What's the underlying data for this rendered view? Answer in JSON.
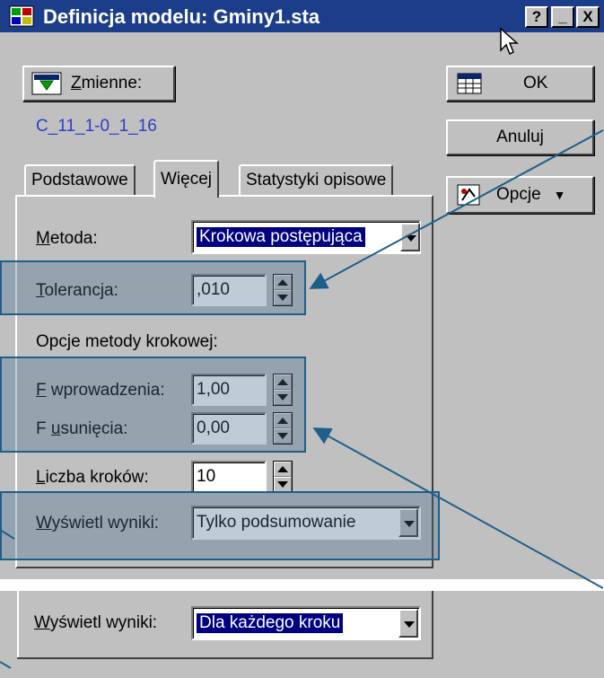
{
  "window": {
    "title": "Definicja modelu: Gminy1.sta",
    "help_button": "?",
    "minimize_button": "_",
    "close_button": "X"
  },
  "toolbar": {
    "variables_prefix": "Z",
    "variables_rest": "mienne:",
    "ok_label": "OK",
    "cancel_label": "Anuluj",
    "options_label": "Opcje"
  },
  "variables_value": "C_11_1-0_1_16",
  "tabs": [
    {
      "label": "Podstawowe"
    },
    {
      "label": "Więcej"
    },
    {
      "label": "Statystyki opisowe"
    }
  ],
  "form": {
    "method_prefix": "M",
    "method_rest": "etoda:",
    "method_value": "Krokowa postępująca",
    "tolerance_prefix": "T",
    "tolerance_rest": "olerancja:",
    "tolerance_value": ",010",
    "stepwise_options_label": "Opcje metody krokowej:",
    "f_enter_prefix": "F",
    "f_enter_rest": " wprowadzenia:",
    "f_enter_value": "1,00",
    "f_remove_first": "F ",
    "f_remove_prefix": "u",
    "f_remove_rest": "sunięcia:",
    "f_remove_value": "0,00",
    "steps_prefix": "L",
    "steps_rest": "iczba kroków:",
    "steps_value": "10",
    "display_prefix": "W",
    "display_rest": "yświetl wyniki:",
    "display_value": "Tylko podsumowanie"
  },
  "alt_panel": {
    "display_prefix": "W",
    "display_rest": "yświetl wyniki:",
    "display_value": "Dla każdego kroku"
  },
  "colors": {
    "title_bar": "#1c3d8a",
    "dialog_bg": "#c0c0c0",
    "highlight": "#1e5f8a",
    "selection": "#000080",
    "variables_text": "#2b3fc8"
  }
}
